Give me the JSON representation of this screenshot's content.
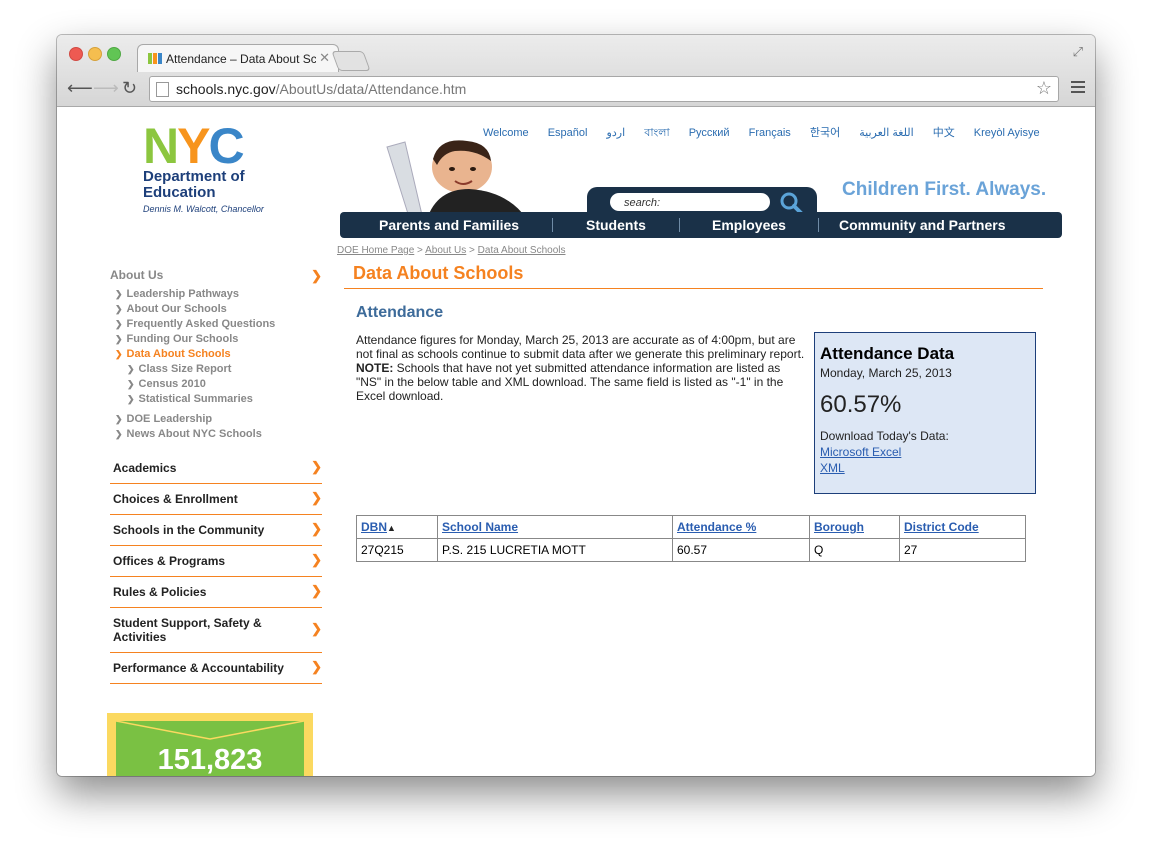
{
  "browser": {
    "tab_title": "Attendance – Data About Schools",
    "url_host": "schools.nyc.gov",
    "url_path": "/AboutUs/data/Attendance.htm"
  },
  "header": {
    "logo": {
      "n": "N",
      "y": "Y",
      "c": "C",
      "dept_line1": "Department of",
      "dept_line2": "Education",
      "chancellor": "Dennis M. Walcott, Chancellor"
    },
    "languages": [
      "Welcome",
      "Español",
      "اردو",
      "বাংলা",
      "Русский",
      "Français",
      "한국어",
      "اللغة العربية",
      "中文",
      "Kreyòl Ayisye"
    ],
    "search_placeholder": "search:",
    "tagline": "Children First.  Always.",
    "nav": [
      "Parents and Families",
      "Students",
      "Employees",
      "Community and Partners"
    ]
  },
  "breadcrumb": {
    "home": "DOE Home Page",
    "sep": ">",
    "about": "About Us",
    "current": "Data About Schools"
  },
  "sidebar": {
    "about_heading": "About Us",
    "about_items": [
      {
        "label": "Leadership Pathways"
      },
      {
        "label": "About Our Schools"
      },
      {
        "label": "Frequently Asked Questions"
      },
      {
        "label": "Funding Our Schools"
      },
      {
        "label": "Data About Schools"
      },
      {
        "label": "Class Size Report"
      },
      {
        "label": "Census 2010"
      },
      {
        "label": "Statistical Summaries"
      },
      {
        "label": "DOE Leadership"
      },
      {
        "label": "News About NYC Schools"
      }
    ],
    "sections": [
      "Academics",
      "Choices & Enrollment",
      "Schools in the Community",
      "Offices & Programs",
      "Rules & Policies",
      "Student Support, Safety & Activities",
      "Performance & Accountability"
    ],
    "counter": "151,823",
    "chevron": "❯"
  },
  "main": {
    "title": "Data About Schools",
    "section": "Attendance",
    "intro": "Attendance figures for Monday, March 25, 2013 are accurate as of 4:00pm, but are not final as schools continue to submit data after we generate this preliminary report.",
    "note_label": "NOTE:",
    "note": " Schools that have not yet submitted attendance information are listed as \"NS\" in the below table and XML download. The same field is listed as \"-1\" in the Excel download."
  },
  "infobox": {
    "title": "Attendance Data",
    "date": "Monday, March 25, 2013",
    "value": "60.57%",
    "download_label": "Download Today's Data:",
    "excel": "Microsoft Excel",
    "xml": "XML"
  },
  "table": {
    "headers": [
      "DBN",
      "School Name",
      "Attendance %",
      "Borough",
      "District Code"
    ],
    "sort_indicator": "▲",
    "rows": [
      [
        "27Q215",
        "P.S. 215 LUCRETIA MOTT",
        "60.57",
        "Q",
        "27"
      ]
    ]
  }
}
